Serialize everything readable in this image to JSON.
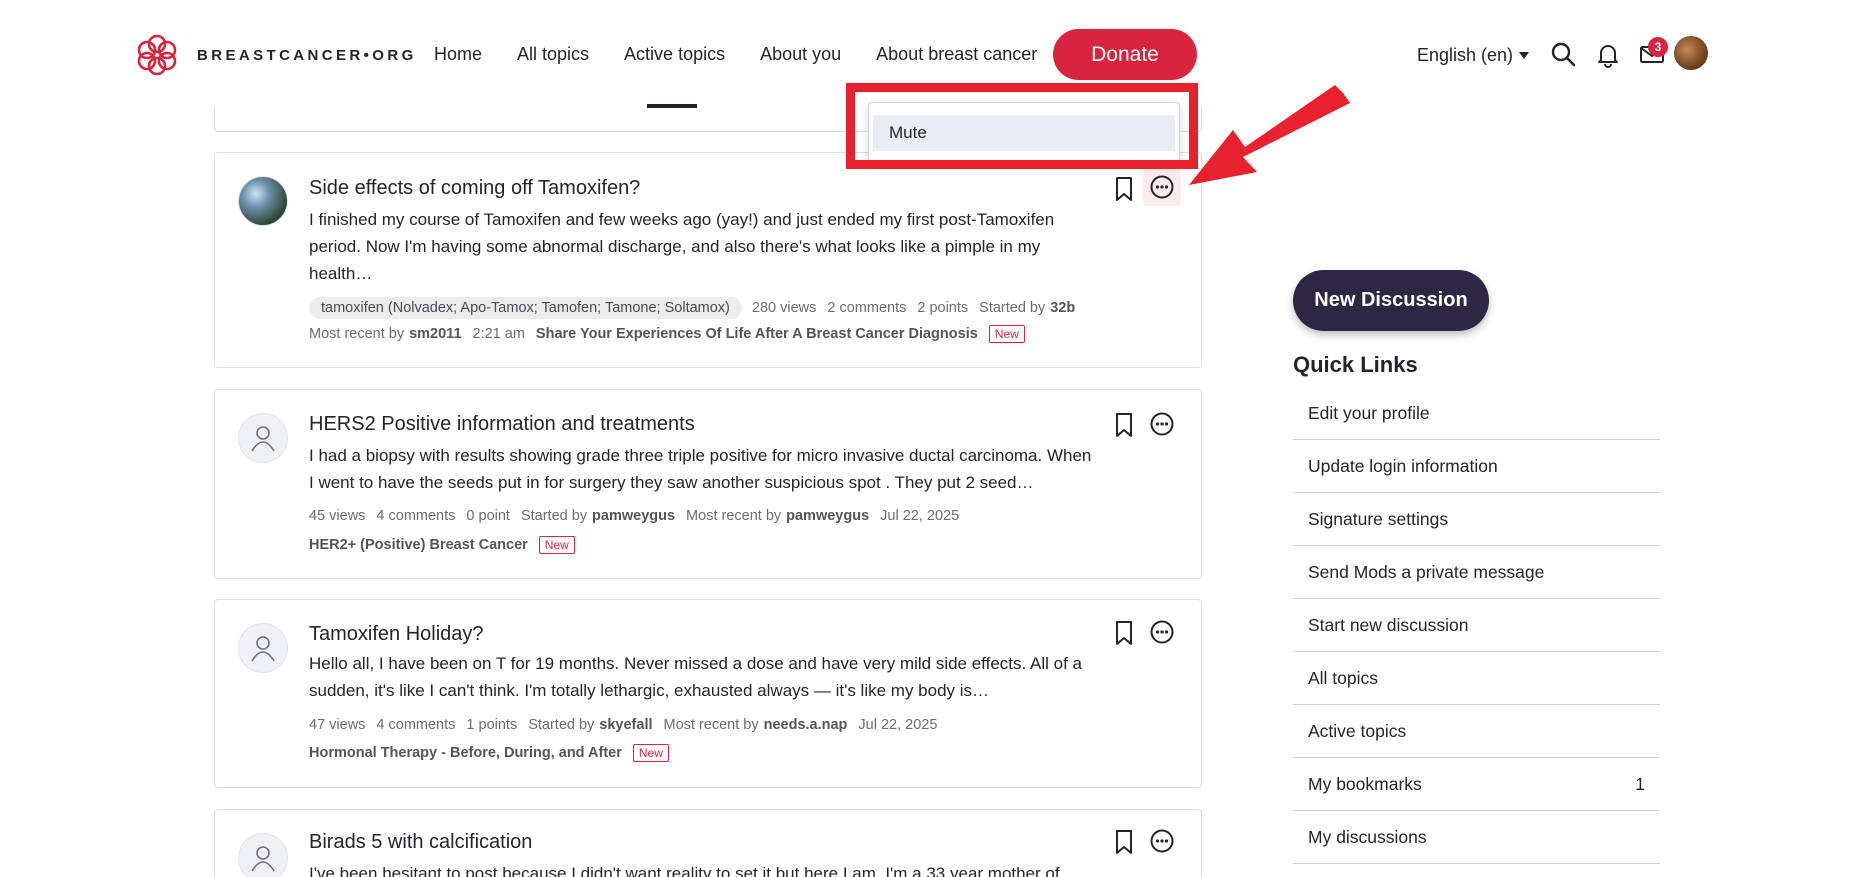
{
  "header": {
    "logo_text": "BREASTCANCER•ORG",
    "nav": [
      "Home",
      "All topics",
      "Active topics",
      "About you",
      "About breast cancer"
    ],
    "donate": "Donate",
    "language": "English (en)",
    "inbox_badge": "3",
    "icons": [
      "search-icon",
      "bell-icon",
      "mail-icon"
    ],
    "brand_color": "#d8243f"
  },
  "dropdown": {
    "mute": "Mute"
  },
  "discussions": [
    {
      "title": "Side effects of coming off Tamoxifen?",
      "excerpt": "I finished my course of Tamoxifen and few weeks ago (yay!) and just ended my first post-Tamoxifen period. Now I'm having some abnormal discharge, and also there's what looks like a pimple in my health…",
      "tag": "tamoxifen (Nolvadex; Apo-Tamox; Tamofen; Tamone; Soltamox)",
      "views": "280 views",
      "comments": "2 comments",
      "points": "2 points",
      "started_prefix": "Started by",
      "started_by": "32b",
      "recent_prefix": "Most recent by",
      "recent_by": "sm2011",
      "time": "2:21 am",
      "category": "Share Your Experiences Of Life After A Breast Cancer Diagnosis",
      "new": "New"
    },
    {
      "title": "HERS2 Positive information and treatments",
      "excerpt": "I had a biopsy with results showing grade three triple positive for micro invasive ductal carcinoma. When I went to have the seeds put in for surgery they saw another suspicious spot . They put 2 seed…",
      "views": "45 views",
      "comments": "4 comments",
      "points": "0 point",
      "started_prefix": "Started by",
      "started_by": "pamweygus",
      "recent_prefix": "Most recent by",
      "recent_by": "pamweygus",
      "time": "Jul 22, 2025",
      "category": "HER2+ (Positive) Breast Cancer",
      "new": "New"
    },
    {
      "title": "Tamoxifen Holiday?",
      "excerpt": "Hello all, I have been on T for 19 months. Never missed a dose and have very mild side effects. All of a sudden, it's like I can't think. I'm totally lethargic, exhausted always — it's like my body is…",
      "views": "47 views",
      "comments": "4 comments",
      "points": "1 points",
      "started_prefix": "Started by",
      "started_by": "skyefall",
      "recent_prefix": "Most recent by",
      "recent_by": "needs.a.nap",
      "time": "Jul 22, 2025",
      "category": "Hormonal Therapy - Before, During, and After",
      "new": "New"
    },
    {
      "title": "Birads 5 with calcification",
      "excerpt": "I've been hesitant to post because I didn't want reality to set it but here I am. I'm a 33 year mother of"
    }
  ],
  "sidebar": {
    "new_discussion": "New Discussion",
    "quick_links_title": "Quick Links",
    "links": [
      {
        "label": "Edit your profile",
        "count": ""
      },
      {
        "label": "Update login information",
        "count": ""
      },
      {
        "label": "Signature settings",
        "count": ""
      },
      {
        "label": "Send Mods a private message",
        "count": ""
      },
      {
        "label": "Start new discussion",
        "count": ""
      },
      {
        "label": "All topics",
        "count": ""
      },
      {
        "label": "Active topics",
        "count": ""
      },
      {
        "label": "My bookmarks",
        "count": "1"
      },
      {
        "label": "My discussions",
        "count": ""
      }
    ]
  }
}
